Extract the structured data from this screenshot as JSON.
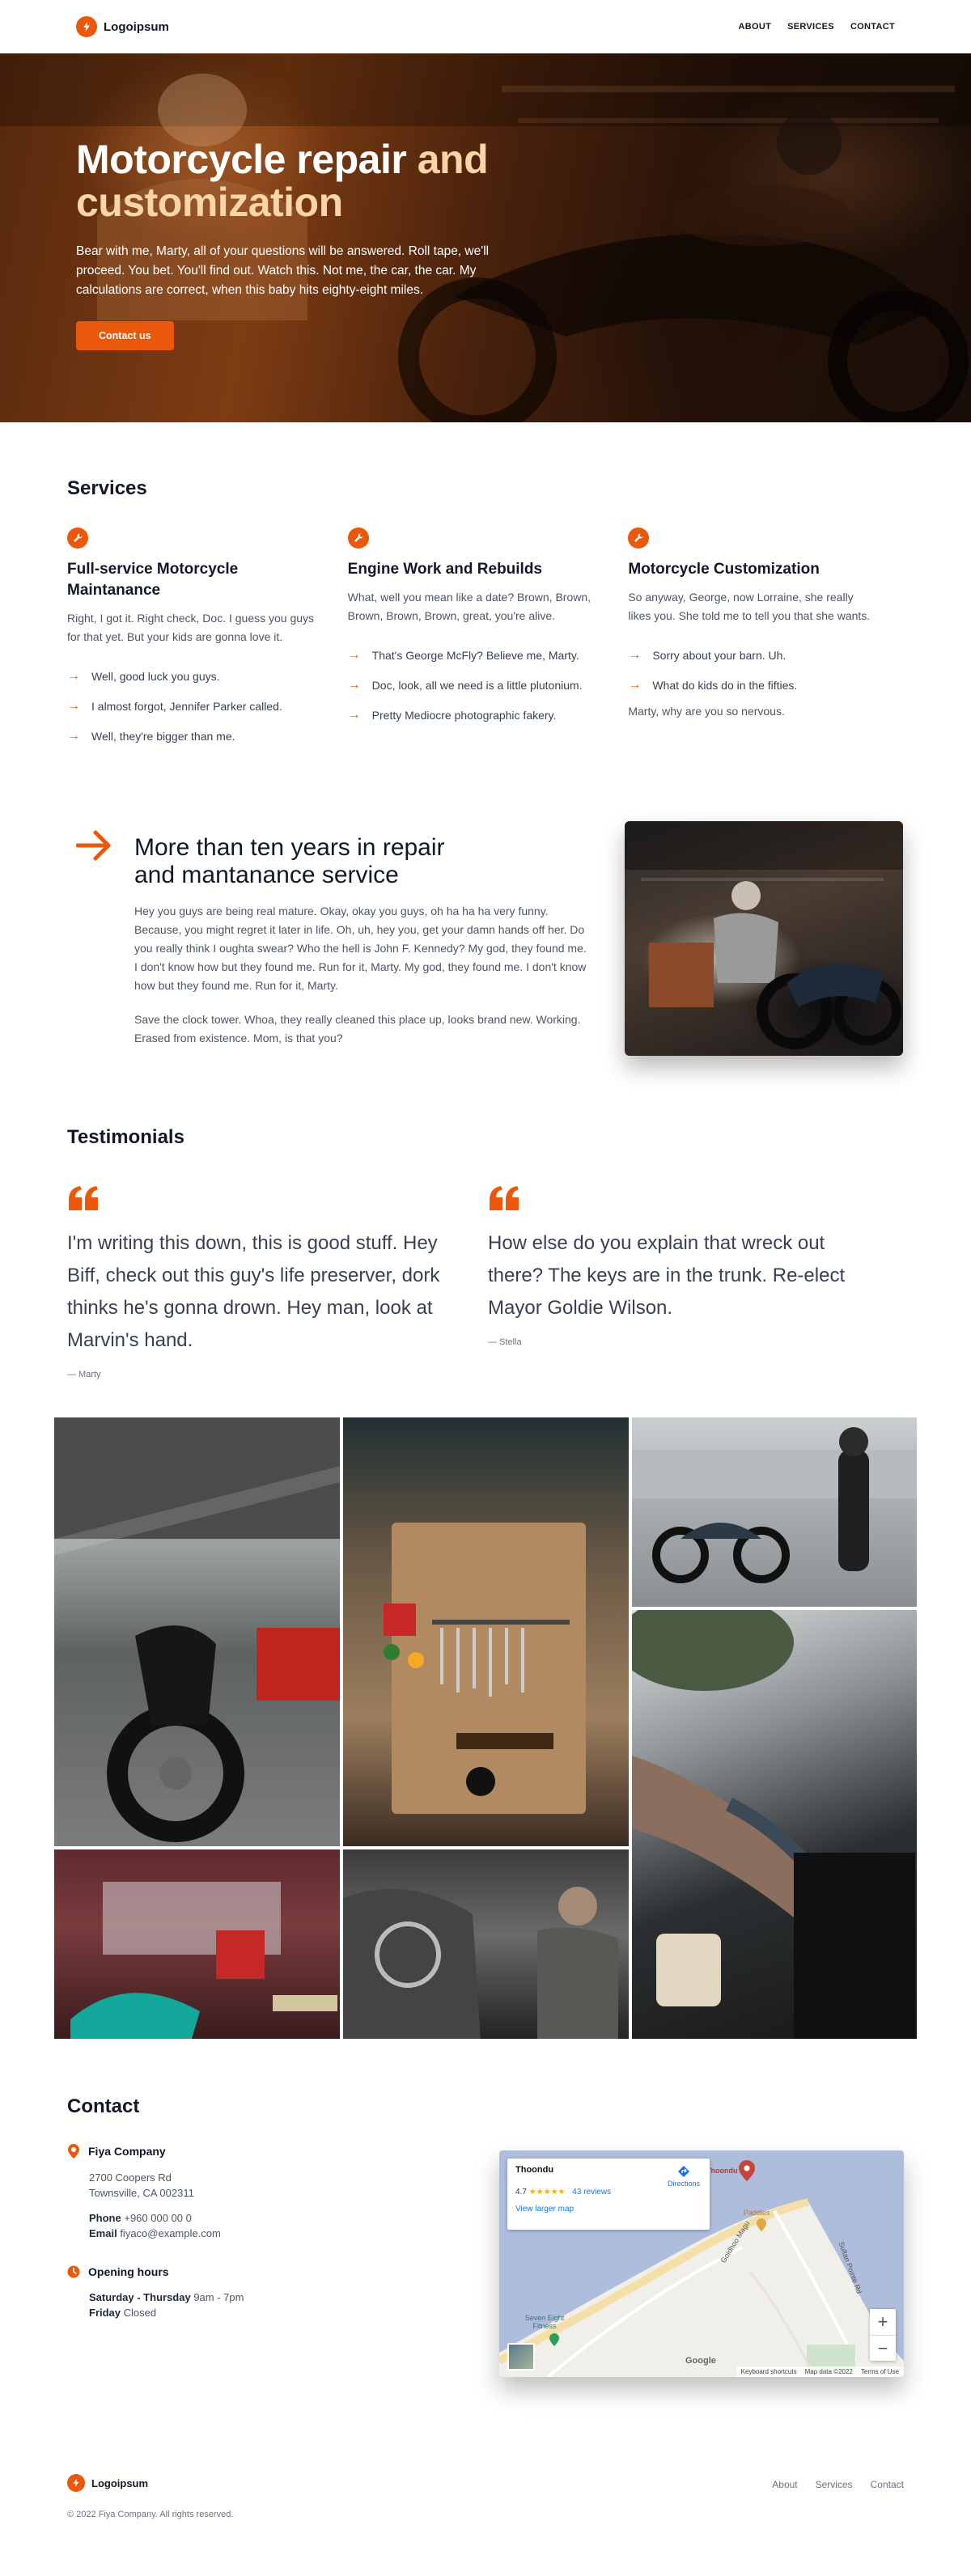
{
  "header": {
    "brand": "Logoipsum",
    "nav": [
      "ABOUT",
      "SERVICES",
      "CONTACT"
    ]
  },
  "hero": {
    "title_main": "Motorcycle repair ",
    "title_tail1": "and",
    "title_tail2": "customization",
    "body": "Bear with me, Marty, all of your questions will be answered. Roll tape, we'll proceed. You bet. You'll find out. Watch this. Not me, the car, the car. My calculations are correct, when this baby hits eighty-eight miles.",
    "cta": "Contact us"
  },
  "services": {
    "title": "Services",
    "items": [
      {
        "title": "Full-service Motorcycle Maintanance",
        "desc": "Right, I got it. Right check, Doc. I guess you guys for that yet. But your kids are gonna love it.",
        "bullets": [
          "Well, good luck you guys.",
          "I almost forgot, Jennifer Parker called.",
          "Well, they're bigger than me."
        ],
        "foot": ""
      },
      {
        "title": "Engine Work and Rebuilds",
        "desc": "What, well you mean like a date? Brown, Brown, Brown, Brown, Brown, great, you're alive.",
        "bullets": [
          "That's George McFly? Believe me, Marty.",
          "Doc, look, all we need is a little plutonium.",
          "Pretty Mediocre photographic fakery."
        ],
        "foot": ""
      },
      {
        "title": "Motorcycle Customization",
        "desc": "So anyway, George, now Lorraine, she really likes you. She told me to tell you that she wants.",
        "bullets": [
          "Sorry about your barn. Uh.",
          "What do kids do in the fifties."
        ],
        "foot": "Marty, why are you so nervous."
      }
    ]
  },
  "about": {
    "title": "More than ten years in repair and mantanance service",
    "p1": "Hey you guys are being real mature. Okay, okay you guys, oh ha ha ha very funny. Because, you might regret it later in life. Oh, uh, hey you, get your damn hands off her. Do you really think I oughta swear? Who the hell is John F. Kennedy? My god, they found me. I don't know how but they found me. Run for it, Marty. My god, they found me. I don't know how but they found me. Run for it, Marty.",
    "p2": "Save the clock tower. Whoa, they really cleaned this place up, looks brand new. Working. Erased from existence. Mom, is that you?"
  },
  "testimonials": {
    "title": "Testimonials",
    "items": [
      {
        "text": "I'm writing this down, this is good stuff. Hey Biff, check out this guy's life preserver, dork thinks he's gonna drown. Hey man, look at Marvin's hand.",
        "author": "— Marty"
      },
      {
        "text": "How else do you explain that wreck out there? The keys are in the trunk. Re-elect Mayor Goldie Wilson.",
        "author": "— Stella"
      }
    ]
  },
  "contact": {
    "title": "Contact",
    "company": "Fiya Company",
    "address1": "2700 Coopers Rd",
    "address2": "Townsville, CA 002311",
    "phone_label": "Phone",
    "phone": "+960 000 00 0",
    "email_label": "Email",
    "email": "fiyaco@example.com",
    "hours_title": "Opening hours",
    "hours1_label": "Saturday - Thursday",
    "hours1": "9am - 7pm",
    "hours2_label": "Friday",
    "hours2": "Closed",
    "map": {
      "place": "Thoondu",
      "rating": "4.7",
      "stars": "★★★★★",
      "reviews": "43 reviews",
      "directions": "Directions",
      "larger": "View larger map",
      "pin_label": "Thoondu",
      "road1": "Goidhoo Magu",
      "road2": "Sultan Pointe Rd",
      "pin2": "Paddles",
      "pin3": "Seven Eight Fitness",
      "google": "Google",
      "footer": [
        "Keyboard shortcuts",
        "Map data ©2022",
        "Terms of Use"
      ],
      "zoom_in": "+",
      "zoom_out": "−"
    }
  },
  "footer": {
    "brand": "Logoipsum",
    "nav": [
      "About",
      "Services",
      "Contact"
    ],
    "copy": "© 2022 Fiya Company. All rights reserved."
  },
  "colors": {
    "accent": "#ea580c",
    "text": "#1f2937",
    "muted": "#4b5563"
  }
}
